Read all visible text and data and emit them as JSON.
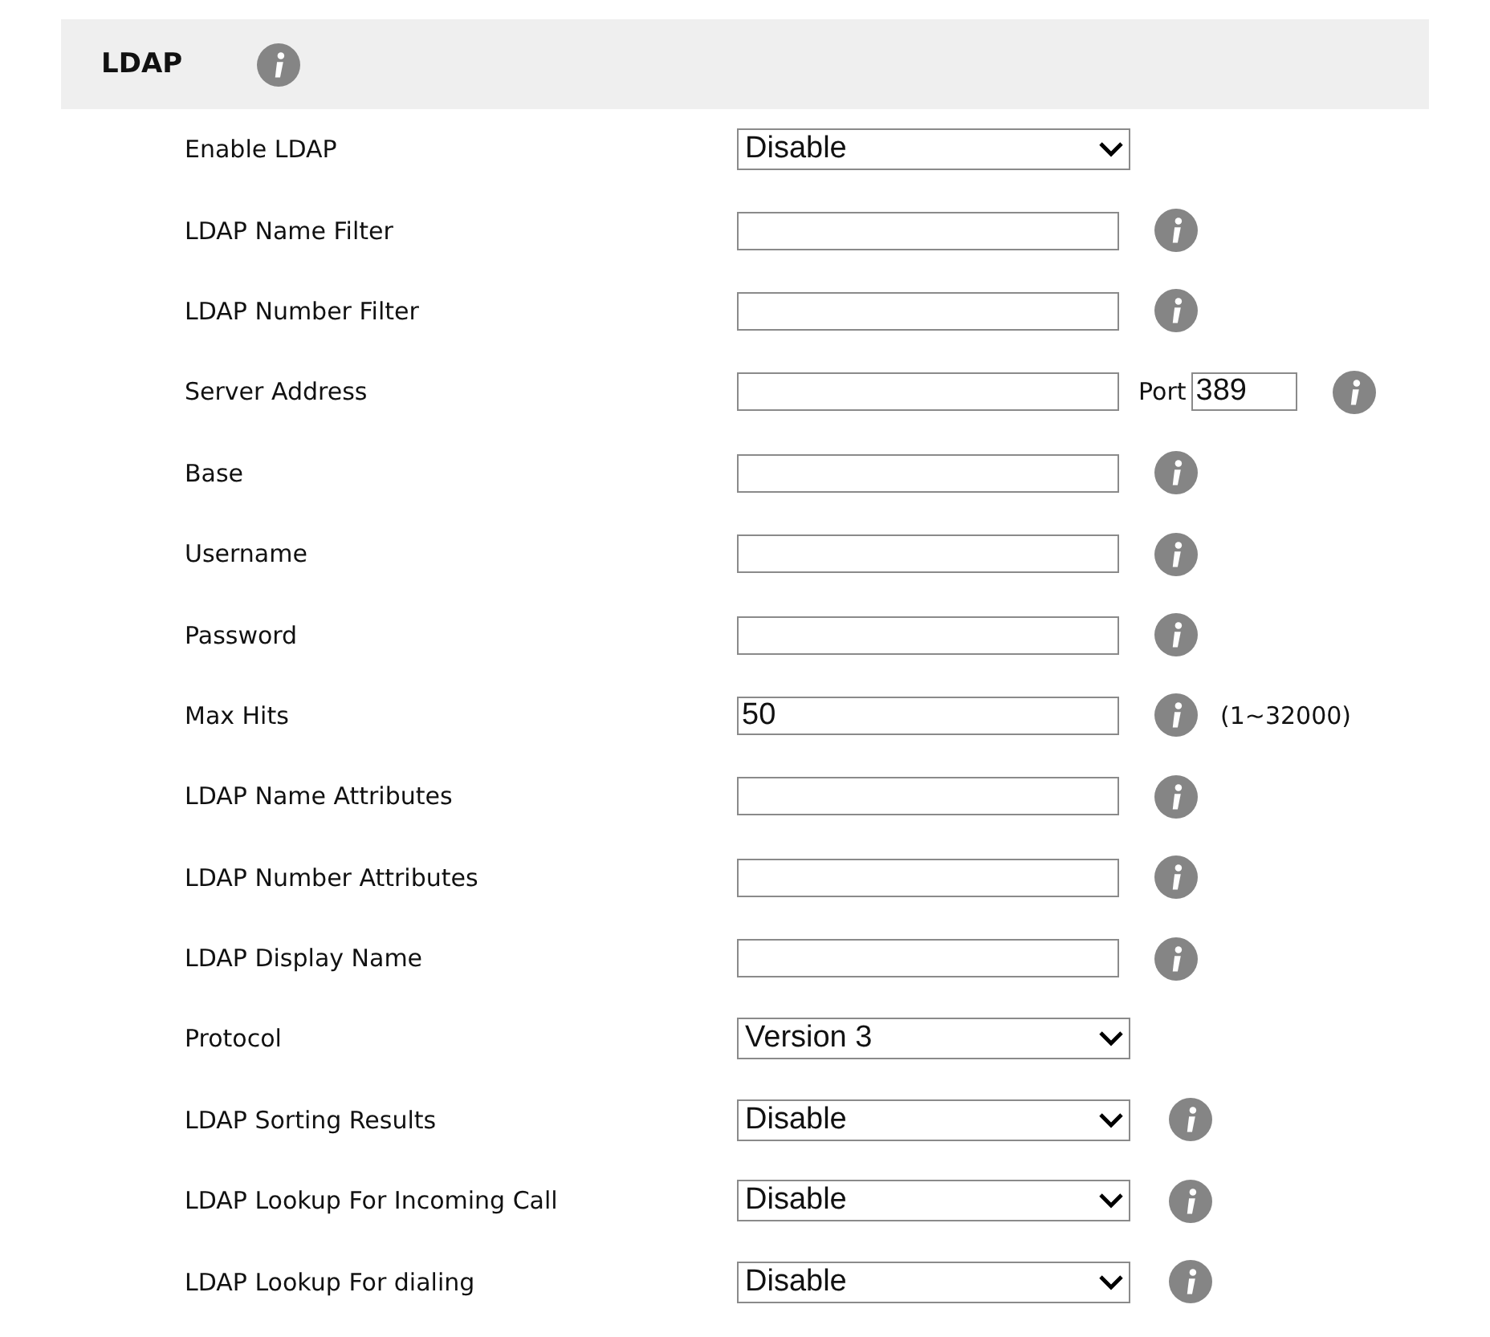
{
  "section": {
    "title": "LDAP",
    "info": true
  },
  "rows": [
    {
      "label": "Enable LDAP",
      "kind": "select",
      "value": "Disable",
      "info": false
    },
    {
      "label": "LDAP Name Filter",
      "kind": "text",
      "info": true
    },
    {
      "label": "LDAP Number Filter",
      "kind": "text",
      "info": true
    },
    {
      "label": "Server Address",
      "kind": "text",
      "info": true,
      "port_label": "Port",
      "port_value": "389"
    },
    {
      "label": "Base",
      "kind": "text",
      "info": true
    },
    {
      "label": "Username",
      "kind": "text",
      "info": true
    },
    {
      "label": "Password",
      "kind": "text",
      "info": true
    },
    {
      "label": "Max Hits",
      "kind": "text",
      "value": "50",
      "info": true,
      "hint": "(1~32000)"
    },
    {
      "label": "LDAP Name Attributes",
      "kind": "text",
      "info": true
    },
    {
      "label": "LDAP Number Attributes",
      "kind": "text",
      "info": true
    },
    {
      "label": "LDAP Display Name",
      "kind": "text",
      "info": true
    },
    {
      "label": "Protocol",
      "kind": "select",
      "value": "Version 3",
      "info": false
    },
    {
      "label": "LDAP Sorting Results",
      "kind": "select",
      "value": "Disable",
      "info": true
    },
    {
      "label": "LDAP Lookup For Incoming Call",
      "kind": "select",
      "value": "Disable",
      "info": true
    },
    {
      "label": "LDAP Lookup For dialing",
      "kind": "select",
      "value": "Disable",
      "info": true
    }
  ]
}
